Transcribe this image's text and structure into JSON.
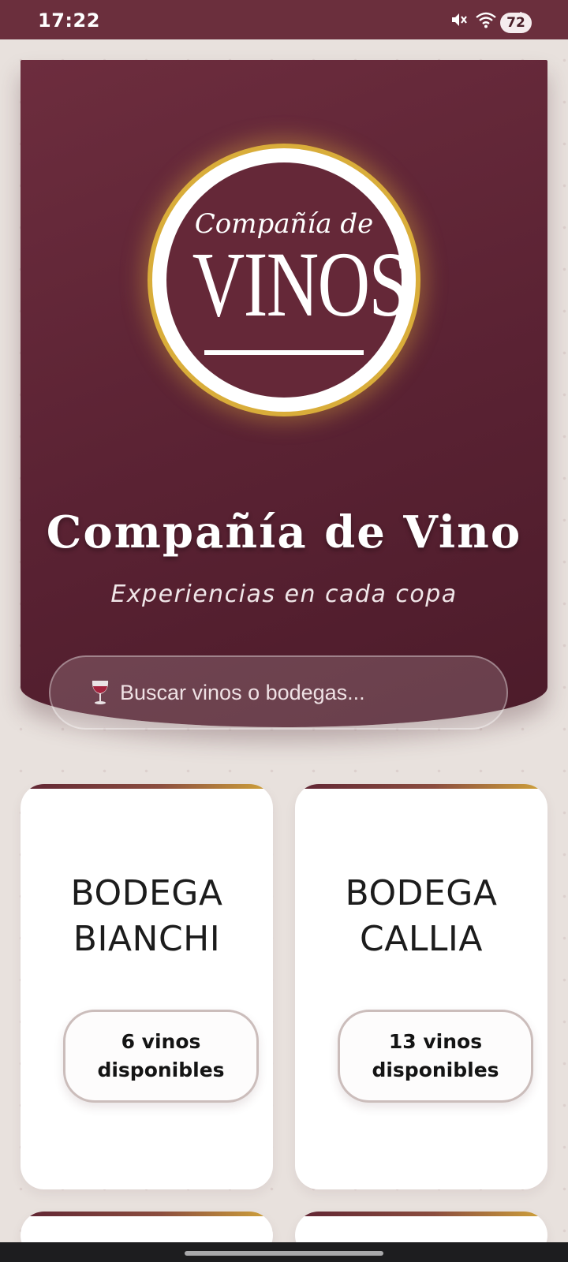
{
  "status_bar": {
    "time": "17:22",
    "battery": "72",
    "icons": [
      "mute-icon",
      "wifi-icon",
      "signal-icon"
    ]
  },
  "hero": {
    "logo": {
      "script_text": "Compañía de",
      "main_text": "VINOS"
    },
    "title": "Compañía de Vino",
    "subtitle": "Experiencias en cada copa",
    "search": {
      "icon": "wine-glass-icon",
      "placeholder": "Buscar vinos o bodegas..."
    }
  },
  "bodegas": [
    {
      "name_line1": "BODEGA",
      "name_line2": "BIANCHI",
      "count_label": "6 vinos disponibles"
    },
    {
      "name_line1": "BODEGA",
      "name_line2": "CALLIA",
      "count_label": "13 vinos disponibles"
    }
  ],
  "colors": {
    "status_bar": "#6b2f3d",
    "hero": "#5a2233",
    "gold": "#d9ad3a",
    "background": "#f3efec"
  }
}
